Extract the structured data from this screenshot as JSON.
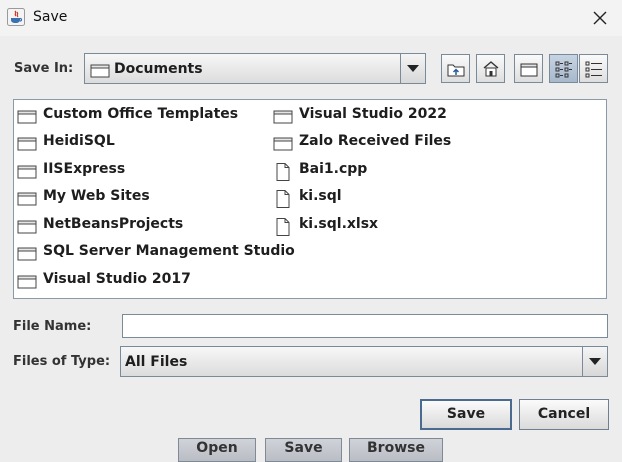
{
  "window": {
    "title": "Save"
  },
  "save_in": {
    "label": "Save In:",
    "value": "Documents"
  },
  "toolbar": {
    "buttons": [
      {
        "name": "up-one-level",
        "icon": "folder-up-icon"
      },
      {
        "name": "home",
        "icon": "home-icon"
      },
      {
        "name": "new-folder",
        "icon": "new-folder-icon"
      },
      {
        "name": "list-view",
        "icon": "list-view-icon",
        "selected": true
      },
      {
        "name": "details-view",
        "icon": "details-view-icon"
      }
    ]
  },
  "files": {
    "column1": [
      {
        "label": "Custom Office Templates",
        "type": "folder"
      },
      {
        "label": "HeidiSQL",
        "type": "folder"
      },
      {
        "label": "IISExpress",
        "type": "folder"
      },
      {
        "label": "My Web Sites",
        "type": "folder"
      },
      {
        "label": "NetBeansProjects",
        "type": "folder"
      },
      {
        "label": "SQL Server Management Studio",
        "type": "folder"
      },
      {
        "label": "Visual Studio 2017",
        "type": "folder"
      }
    ],
    "column2": [
      {
        "label": "Visual Studio 2022",
        "type": "folder"
      },
      {
        "label": "Zalo Received Files",
        "type": "folder"
      },
      {
        "label": "Bai1.cpp",
        "type": "file"
      },
      {
        "label": "ki.sql",
        "type": "file"
      },
      {
        "label": "ki.sql.xlsx",
        "type": "file"
      }
    ]
  },
  "file_name": {
    "label": "File Name:",
    "value": ""
  },
  "files_of_type": {
    "label": "Files of Type:",
    "value": "All Files"
  },
  "buttons": {
    "save": "Save",
    "cancel": "Cancel"
  },
  "background_buttons": {
    "open": "Open",
    "save": "Save",
    "browse": "Browse"
  }
}
